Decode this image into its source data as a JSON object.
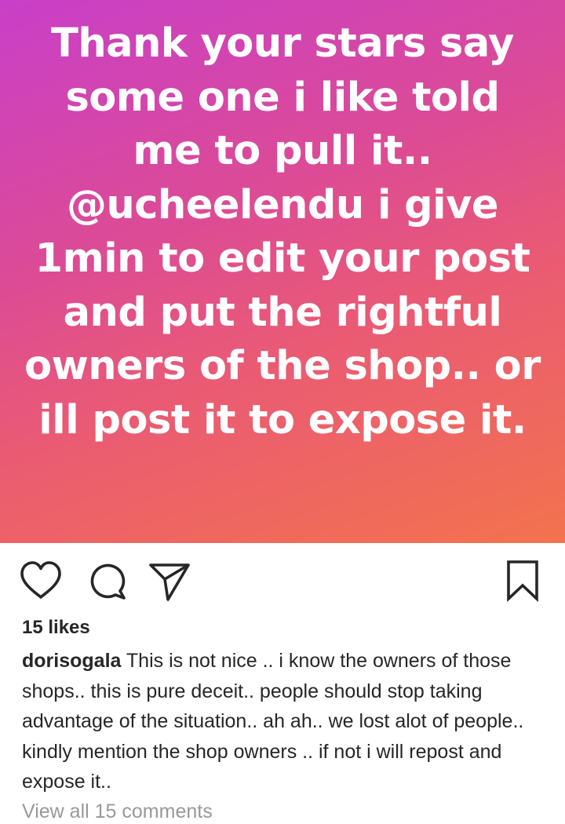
{
  "post": {
    "story_lines": [
      "Thank your stars say",
      "some one i like told",
      "me to pull it..",
      "@ucheelendu i give",
      "1min to edit your post",
      "and put the rightful",
      "owners of the shop.. or",
      "ill post it to expose it."
    ],
    "background_colors": [
      "#c93fc8",
      "#dc4b95",
      "#ea5b73",
      "#f3734e"
    ]
  },
  "actions": {
    "like_icon": "heart-icon",
    "comment_icon": "comment-icon",
    "share_icon": "paper-plane-icon",
    "save_icon": "bookmark-icon"
  },
  "likes": "15 likes",
  "caption": {
    "username": "dorisogala",
    "text": " This is not nice .. i know the owners of those shops.. this is pure deceit.. people should stop taking advantage of the situation.. ah ah.. we lost alot of people.. kindly mention the shop owners .. if not i will repost and expose it.."
  },
  "view_comments": "View all 15 comments"
}
